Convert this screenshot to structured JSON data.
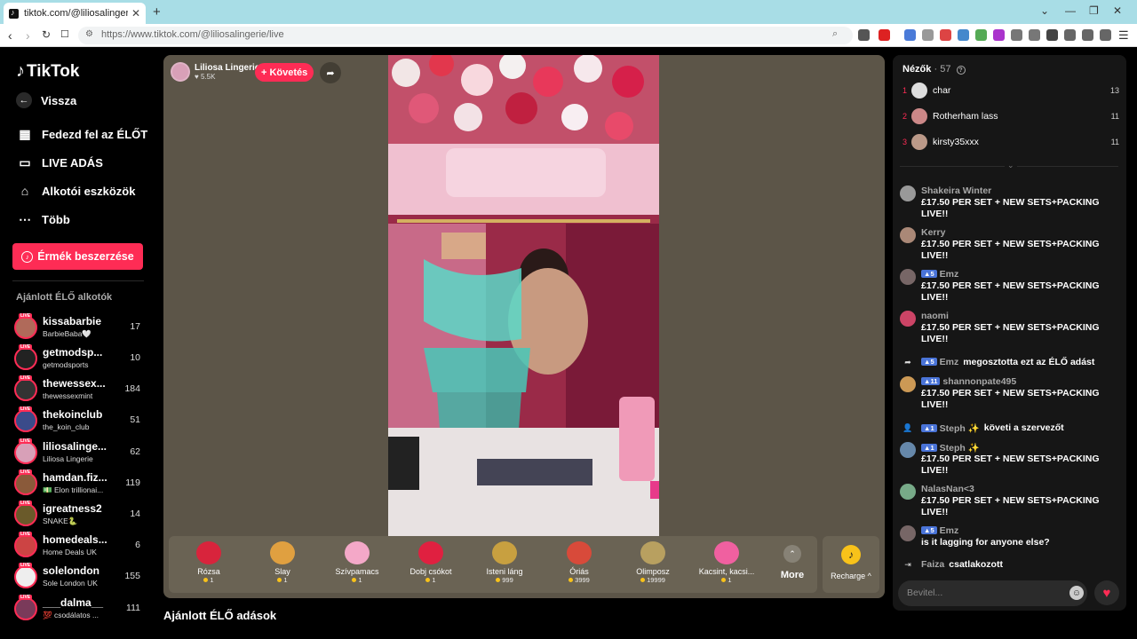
{
  "browser": {
    "tab_title": "tiktok.com/@liliosalingerie/li",
    "url": "https://www.tiktok.com/@liliosalingerie/live"
  },
  "sidebar": {
    "logo": "TikTok",
    "back": "Vissza",
    "nav": [
      {
        "label": "Fedezd fel az ÉLŐT",
        "icon": "calendar-live-icon"
      },
      {
        "label": "LIVE ADÁS",
        "icon": "video-camera-icon"
      },
      {
        "label": "Alkotói eszközök",
        "icon": "creator-tools-icon"
      },
      {
        "label": "Több",
        "icon": "more-dots-icon"
      }
    ],
    "buy_coins": "Érmék beszerzése",
    "recommended_header": "Ajánlott ÉLŐ alkotók",
    "creators": [
      {
        "name": "kissabarbie",
        "sub": "BarbieBaba🤍",
        "count": "17",
        "color": "#b06a5a"
      },
      {
        "name": "getmodsp...",
        "sub": "getmodsports",
        "count": "10",
        "color": "#222"
      },
      {
        "name": "thewessex...",
        "sub": "thewessexmint",
        "count": "184",
        "color": "#333"
      },
      {
        "name": "thekoinclub",
        "sub": "the_koin_club",
        "count": "51",
        "color": "#3a4b8a"
      },
      {
        "name": "liliosalinge...",
        "sub": "Liliosa Lingerie",
        "count": "62",
        "color": "#d8a0b8"
      },
      {
        "name": "hamdan.fiz...",
        "sub": "💵 Elon trillionai...",
        "count": "119",
        "color": "#8a5a3a"
      },
      {
        "name": "igreatness2",
        "sub": "SNAKE🐍",
        "count": "14",
        "color": "#6a5a2a"
      },
      {
        "name": "homedeals...",
        "sub": "Home Deals UK",
        "count": "6",
        "color": "#c44"
      },
      {
        "name": "solelondon",
        "sub": "Sole London UK",
        "count": "155",
        "color": "#eee"
      },
      {
        "name": "___dalma__",
        "sub": "💯 csodálatos ...",
        "count": "111",
        "color": "#7a3a5a"
      }
    ]
  },
  "stage": {
    "host_name": "Liliosa Lingerie",
    "likes": "5.5K",
    "follow": "+ Követés",
    "gifts": [
      {
        "name": "Rózsa",
        "price": "1",
        "color": "#d8243c"
      },
      {
        "name": "Slay",
        "price": "1",
        "color": "#e0a040"
      },
      {
        "name": "Szívpamacs",
        "price": "1",
        "color": "#f4a8c8"
      },
      {
        "name": "Dobj csókot",
        "price": "1",
        "color": "#e02040"
      },
      {
        "name": "Isteni láng",
        "price": "999",
        "color": "#c8a040"
      },
      {
        "name": "Óriás",
        "price": "3999",
        "color": "#d84a3a"
      },
      {
        "name": "Olimposz",
        "price": "19999",
        "color": "#b8a060"
      },
      {
        "name": "Kacsint, kacsi...",
        "price": "1",
        "color": "#f060a0"
      }
    ],
    "more": "More",
    "recharge": "Recharge ^",
    "recommended_live": "Ajánlott ÉLŐ adások"
  },
  "chat": {
    "viewers_label": "Nézők",
    "viewers_count": "57",
    "top_viewers": [
      {
        "rank": "1",
        "name": "char",
        "score": "13",
        "color": "#ddd"
      },
      {
        "rank": "2",
        "name": "Rotherham lass",
        "score": "11",
        "color": "#c88"
      },
      {
        "rank": "3",
        "name": "kirsty35xxx",
        "score": "11",
        "color": "#b98"
      }
    ],
    "messages": [
      {
        "type": "msg",
        "name": "Shakeira Winter",
        "level": "",
        "text": "£17.50 PER SET + NEW SETS+PACKING LIVE!!",
        "color": "#999"
      },
      {
        "type": "msg",
        "name": "Kerry",
        "level": "",
        "text": "£17.50 PER SET + NEW SETS+PACKING LIVE!!",
        "color": "#a87"
      },
      {
        "type": "msg",
        "name": "Emz",
        "level": "5",
        "text": "£17.50 PER SET + NEW SETS+PACKING LIVE!!",
        "color": "#766"
      },
      {
        "type": "msg",
        "name": "naomi",
        "level": "",
        "text": "£17.50 PER SET + NEW SETS+PACKING LIVE!!",
        "color": "#c46"
      },
      {
        "type": "sys",
        "icon": "↪",
        "name": "Emz",
        "level": "5",
        "text": "megosztotta ezt az ÉLŐ adást"
      },
      {
        "type": "msg",
        "name": "shannonpate495",
        "level": "11",
        "text": "£17.50 PER SET + NEW SETS+PACKING LIVE!!",
        "color": "#c95"
      },
      {
        "type": "sys",
        "icon": "👤",
        "name": "Steph ✨",
        "level": "1",
        "text": "követi a szervezőt"
      },
      {
        "type": "msg",
        "name": "Steph ✨",
        "level": "1",
        "text": "£17.50 PER SET + NEW SETS+PACKING LIVE!!",
        "color": "#68a"
      },
      {
        "type": "msg",
        "name": "NalasNan<3",
        "level": "",
        "text": "£17.50 PER SET + NEW SETS+PACKING LIVE!!",
        "color": "#7a8"
      },
      {
        "type": "msg",
        "name": "Emz",
        "level": "5",
        "text": "is it lagging for anyone else?",
        "color": "#766"
      },
      {
        "type": "sys",
        "icon": "⇥",
        "name": "Faiza",
        "level": "",
        "text": "csatlakozott"
      }
    ],
    "input_placeholder": "Bevitel..."
  }
}
